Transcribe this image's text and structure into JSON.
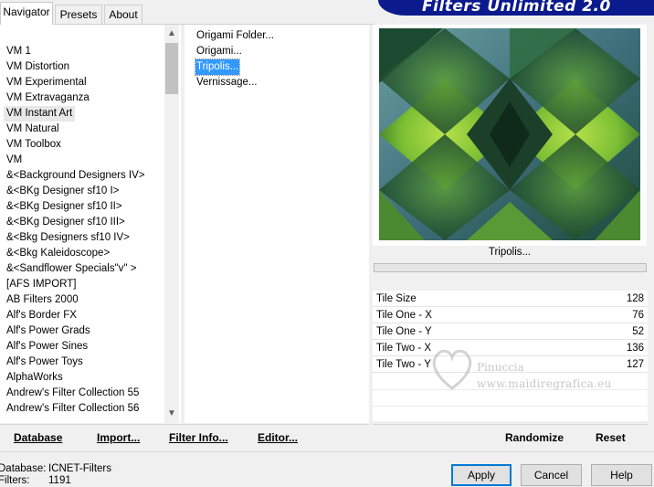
{
  "tabs": [
    {
      "label": "Navigator",
      "active": true
    },
    {
      "label": "Presets",
      "active": false
    },
    {
      "label": "About",
      "active": false
    }
  ],
  "banner": {
    "title": "Filters Unlimited 2.0"
  },
  "categories": {
    "items": [
      "VM 1",
      "VM Distortion",
      "VM Experimental",
      "VM Extravaganza",
      "VM Instant Art",
      "VM Natural",
      "VM Toolbox",
      "VM",
      "&<Background Designers IV>",
      "&<BKg Designer sf10 I>",
      "&<BKg Designer sf10 II>",
      "&<BKg Designer sf10 III>",
      "&<Bkg Designers sf10 IV>",
      "&<Bkg Kaleidoscope>",
      "&<Sandflower Specials\"v\" >",
      "[AFS IMPORT]",
      "AB Filters 2000",
      "Alf's Border FX",
      "Alf's Power Grads",
      "Alf's Power Sines",
      "Alf's Power Toys",
      "AlphaWorks",
      "Andrew's Filter Collection 55",
      "Andrew's Filter Collection 56"
    ],
    "selected_index": 4
  },
  "filters": {
    "items": [
      "Origami Folder...",
      "Origami...",
      "Tripolis...",
      "Vernissage..."
    ],
    "selected_index": 2
  },
  "preview": {
    "filter_name": "Tripolis...",
    "colors": {
      "dark": "#1f4a2a",
      "mid": "#3f7a2e",
      "light": "#8ec63a",
      "blue": "#4f7f86"
    }
  },
  "parameters": [
    {
      "label": "Tile Size",
      "value": "128"
    },
    {
      "label": "Tile One - X",
      "value": "76"
    },
    {
      "label": "Tile One - Y",
      "value": "52"
    },
    {
      "label": "Tile Two - X",
      "value": "136"
    },
    {
      "label": "Tile Two - Y",
      "value": "127"
    }
  ],
  "watermark": {
    "name": "Pinuccia",
    "url": "www.maidiregrafica.eu"
  },
  "links": {
    "database": "Database",
    "import": "Import...",
    "filter_info": "Filter Info...",
    "editor": "Editor..."
  },
  "actions": {
    "randomize": "Randomize",
    "reset": "Reset"
  },
  "footer": {
    "database_label": "Database:",
    "database_value": "ICNET-Filters",
    "filters_label": "Filters:",
    "filters_value": "1191"
  },
  "buttons": {
    "apply": "Apply",
    "cancel": "Cancel",
    "help": "Help"
  }
}
